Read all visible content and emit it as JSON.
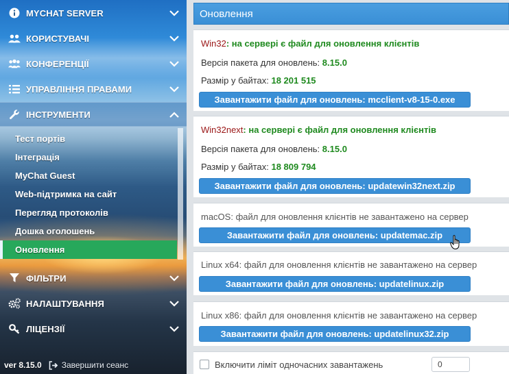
{
  "sidebar": {
    "menu": [
      {
        "label": "MYCHAT SERVER",
        "icon": "info-icon"
      },
      {
        "label": "КОРИСТУВАЧІ",
        "icon": "users-icon"
      },
      {
        "label": "КОНФЕРЕНЦІЇ",
        "icon": "conference-icon"
      },
      {
        "label": "УПРАВЛІННЯ ПРАВАМИ",
        "icon": "list-icon"
      },
      {
        "label": "ІНСТРУМЕНТИ",
        "icon": "wrench-icon"
      }
    ],
    "tools_sub": [
      {
        "label": "Тест портів"
      },
      {
        "label": "Інтеграція"
      },
      {
        "label": "MyChat Guest"
      },
      {
        "label": "Web-підтримка на сайт"
      },
      {
        "label": "Перегляд протоколів"
      },
      {
        "label": "Дошка оголошень"
      },
      {
        "label": "Оновлення"
      }
    ],
    "menu_bottom": [
      {
        "label": "ФІЛЬТРИ",
        "icon": "filter-icon"
      },
      {
        "label": "НАЛАШТУВАННЯ",
        "icon": "gears-icon"
      },
      {
        "label": "ЛІЦЕНЗІЇ",
        "icon": "key-icon"
      }
    ],
    "footer": {
      "version": "ver 8.15.0",
      "logout": "Завершити сеанс"
    }
  },
  "main": {
    "title": "Оновлення",
    "cards": [
      {
        "os": "Win32",
        "status": ": на сервері є файл для оновлення клієнтів",
        "version_label": "Версія пакета для оновлень: ",
        "version": "8.15.0",
        "size_label": "Размір у байтах: ",
        "size": "18 201 515",
        "button": "Завантажити файл для оновлень: mcclient-v8-15-0.exe"
      },
      {
        "os": "Win32next",
        "status": ": на сервері є файл для оновлення клієнтів",
        "version_label": "Версія пакета для оновлень: ",
        "version": "8.15.0",
        "size_label": "Размір у байтах: ",
        "size": "18 809 794",
        "button": "Завантажити файл для оновлень: updatewin32next.zip"
      },
      {
        "status": "macOS: файл для оновлення клієнтів не завантажено на сервер",
        "button": "Завантажити файл для оновлень: updatemac.zip"
      },
      {
        "status": "Linux x64: файл для оновлення клієнтів не завантажено на сервер",
        "button": "Завантажити файл для оновлень: updatelinux.zip"
      },
      {
        "status": "Linux x86: файл для оновлення клієнтів не завантажено на сервер",
        "button": "Завантажити файл для оновлень: updatelinux32.zip"
      }
    ],
    "limit": {
      "label": "Включити ліміт одночасних завантажень",
      "value": "0",
      "checked": false
    }
  },
  "colors": {
    "accent": "#3a8fd6",
    "active_item": "#27a85b",
    "ok_text": "#1f8a1f",
    "os_text": "#9a1616"
  }
}
